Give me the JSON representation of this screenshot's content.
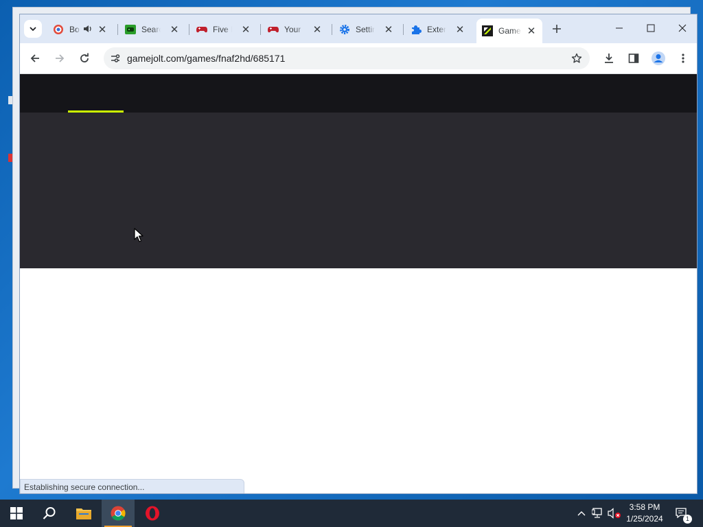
{
  "browser": {
    "tabs": [
      {
        "title": "Bo",
        "favicon": "target-icon",
        "audio": true
      },
      {
        "title": "Search",
        "favicon": "gamepad-green-icon"
      },
      {
        "title": "Five N",
        "favicon": "gamepad-red-icon"
      },
      {
        "title": "Your F",
        "favicon": "gamepad-red-icon"
      },
      {
        "title": "Settings",
        "favicon": "gear-icon"
      },
      {
        "title": "Extens",
        "favicon": "puzzle-icon"
      },
      {
        "title": "Game",
        "favicon": "gamejolt-icon",
        "active": true
      }
    ],
    "url": "gamejolt.com/games/fnaf2hd/685171",
    "status_text": "Establishing secure connection..."
  },
  "page": {
    "loading_bar_color": "#ccff00",
    "header_color": "#151519",
    "hero_color": "#2a292f"
  },
  "taskbar": {
    "time": "3:58 PM",
    "date": "1/25/2024",
    "notification_count": "1"
  }
}
